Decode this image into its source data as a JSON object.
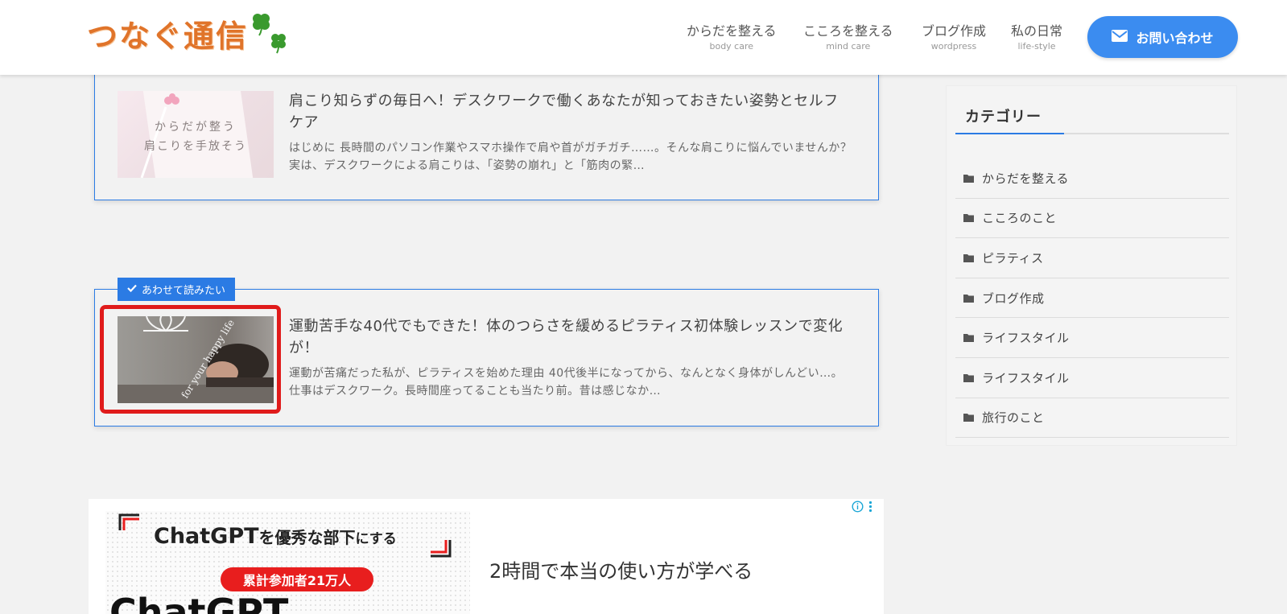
{
  "header": {
    "logo_text": "つなぐ通信",
    "nav": [
      {
        "label": "からだを整える",
        "sub": "body care"
      },
      {
        "label": "こころを整える",
        "sub": "mind care"
      },
      {
        "label": "ブログ作成",
        "sub": "wordpress"
      },
      {
        "label": "私の日常",
        "sub": "life-style"
      }
    ],
    "contact_label": "お問い合わせ"
  },
  "cards": [
    {
      "title": "肩こり知らずの毎日へ！デスクワークで働くあなたが知っておきたい姿勢とセルフケア",
      "excerpt": "はじめに 長時間のパソコン作業やスマホ操作で肩や首がガチガチ……。そんな肩こりに悩んでいませんか？ 実は、デスクワークによる肩こりは、「姿勢の崩れ」と「筋肉の緊…",
      "thumb_lines": [
        "からだが整う",
        "肩こりを手放そう"
      ]
    },
    {
      "label": "あわせて読みたい",
      "title": "運動苦手な40代でもできた！体のつらさを緩めるピラティス初体験レッスンで変化が！",
      "excerpt": "運動が苦痛だった私が、ピラティスを始めた理由 40代後半になってから、なんとなく身体がしんどい…。 仕事はデスクワーク。長時間座ってることも当たり前。昔は感じなか…",
      "thumb_text": "for your happy life"
    }
  ],
  "sidebar": {
    "title": "カテゴリー",
    "items": [
      "からだを整える",
      "こころのこと",
      "ピラティス",
      "ブログ作成",
      "ライフスタイル",
      "ライフスタイル",
      "旅行のこと"
    ]
  },
  "ad": {
    "headline_a": "ChatGPT",
    "headline_b": "を優秀な部下",
    "headline_c": "にする",
    "pill": "累計参加者21万人",
    "big": "ChatGPT",
    "tagline": "2時間で本当の使い方が学べる"
  },
  "colors": {
    "accent": "#2b7be4",
    "button": "#3b8cf0",
    "logo": "#e0742a",
    "highlight": "#e01b1b"
  }
}
